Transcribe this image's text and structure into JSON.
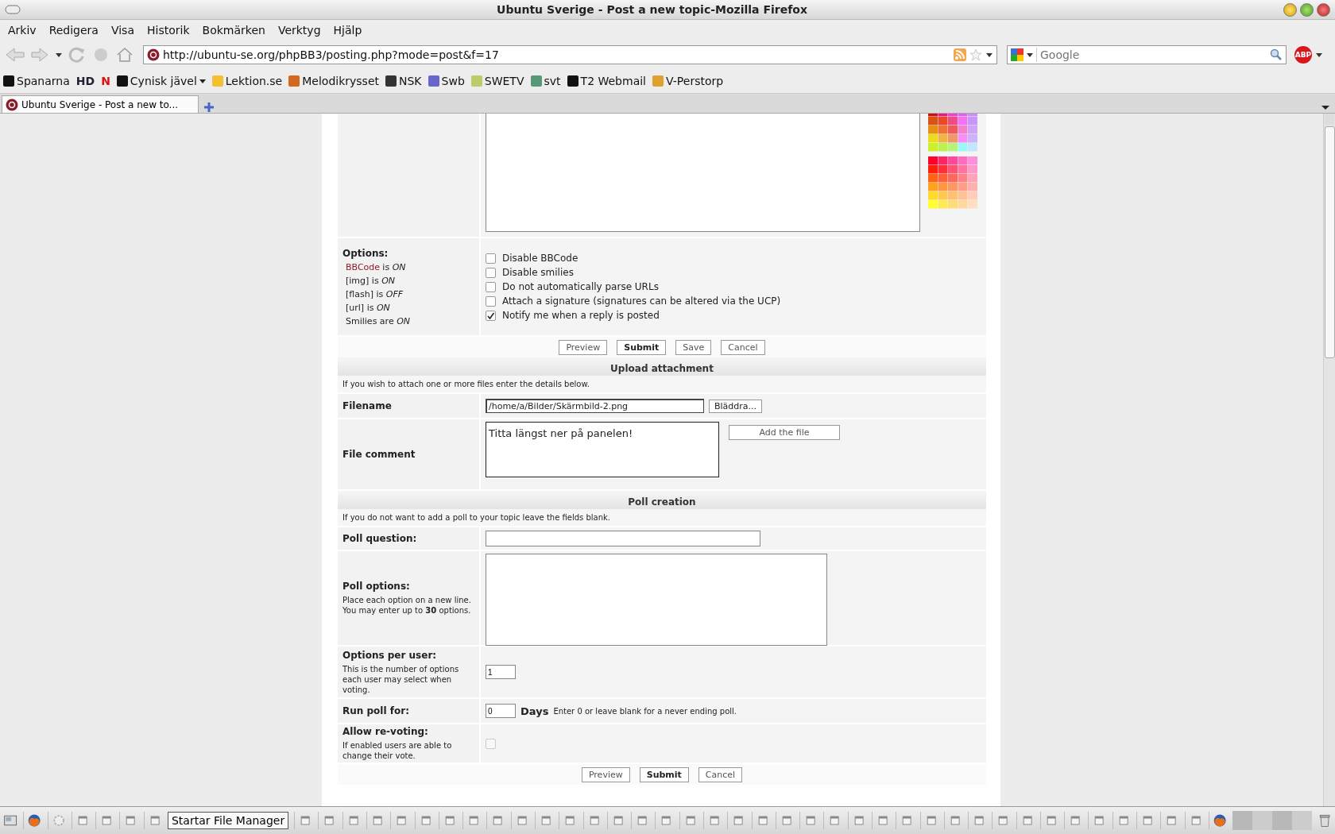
{
  "window": {
    "title": "Ubuntu Sverige - Post a new topic-Mozilla Firefox"
  },
  "menu": [
    "Arkiv",
    "Redigera",
    "Visa",
    "Historik",
    "Bokmärken",
    "Verktyg",
    "Hjälp"
  ],
  "toolbar": {
    "url": "http://ubuntu-se.org/phpBB3/posting.php?mode=post&f=17",
    "search": {
      "placeholder": "Google"
    },
    "adblock": "ABP"
  },
  "bookmarks": [
    {
      "label": "Spanarna",
      "kind": "text",
      "folder": false
    },
    {
      "label": "HD",
      "kind": "logo",
      "folder": false
    },
    {
      "label": "N",
      "kind": "logo",
      "folder": false
    },
    {
      "label": "Cynisk jävel",
      "kind": "text",
      "folder": true
    },
    {
      "label": "Lektion.se",
      "kind": "text",
      "folder": false
    },
    {
      "label": "Melodikrysset",
      "kind": "text",
      "folder": false
    },
    {
      "label": "NSK",
      "kind": "text",
      "folder": false
    },
    {
      "label": "Swb",
      "kind": "text",
      "folder": false
    },
    {
      "label": "SWETV",
      "kind": "text",
      "folder": false
    },
    {
      "label": "svt",
      "kind": "text",
      "folder": false
    },
    {
      "label": "T2 Webmail",
      "kind": "text",
      "folder": false
    },
    {
      "label": "V-Perstorp",
      "kind": "text",
      "folder": false
    }
  ],
  "tabs": [
    {
      "label": "Ubuntu Sverige - Post a new to...",
      "selected": true
    }
  ],
  "options": {
    "title": "Options:",
    "status": [
      {
        "link": "BBCode",
        "text": "is *ON*"
      },
      {
        "text": "[img] is *ON*"
      },
      {
        "text": "[flash] is *OFF*"
      },
      {
        "text": "[url] is *ON*"
      },
      {
        "text": "Smilies are *ON*"
      }
    ],
    "checkboxes": [
      {
        "label": "Disable BBCode",
        "checked": false
      },
      {
        "label": "Disable smilies",
        "checked": false
      },
      {
        "label": "Do not automatically parse URLs",
        "checked": false
      },
      {
        "label": "Attach a signature (signatures can be altered via the UCP)",
        "checked": false
      },
      {
        "label": "Notify me when a reply is posted",
        "checked": true
      }
    ],
    "buttons": [
      {
        "label": "Preview",
        "primary": false
      },
      {
        "label": "Submit",
        "primary": true
      },
      {
        "label": "Save",
        "primary": false
      },
      {
        "label": "Cancel",
        "primary": false
      }
    ]
  },
  "upload": {
    "title": "Upload attachment",
    "hint": "If you wish to attach one or more files enter the details below.",
    "filename": {
      "label": "Filename",
      "value": "/home/a/Bilder/Skärmbild-2.png",
      "browse": "Bläddra..."
    },
    "comment": {
      "label": "File comment",
      "value": "Titta längst ner på panelen!"
    },
    "add_button": "Add the file"
  },
  "poll": {
    "title": "Poll creation",
    "hint": "If you do not want to add a poll to your topic leave the fields blank.",
    "question": {
      "label": "Poll question:"
    },
    "options": {
      "label": "Poll options:",
      "help": "Place each option on a new line. You may enter up to **30** options."
    },
    "per_user": {
      "label": "Options per user:",
      "help": "This is the number of options each user may select when voting.",
      "value": "1"
    },
    "run_for": {
      "label": "Run poll for:",
      "value": "0",
      "unit": "Days",
      "help": "Enter 0 or leave blank for a never ending poll."
    },
    "revote": {
      "label": "Allow re-voting:",
      "help": "If enabled users are able to change their vote.",
      "checked": false
    },
    "buttons": [
      {
        "label": "Preview",
        "primary": false
      },
      {
        "label": "Submit",
        "primary": true
      },
      {
        "label": "Cancel",
        "primary": false
      }
    ]
  },
  "taskbar": {
    "task": "Startar File Manager"
  }
}
